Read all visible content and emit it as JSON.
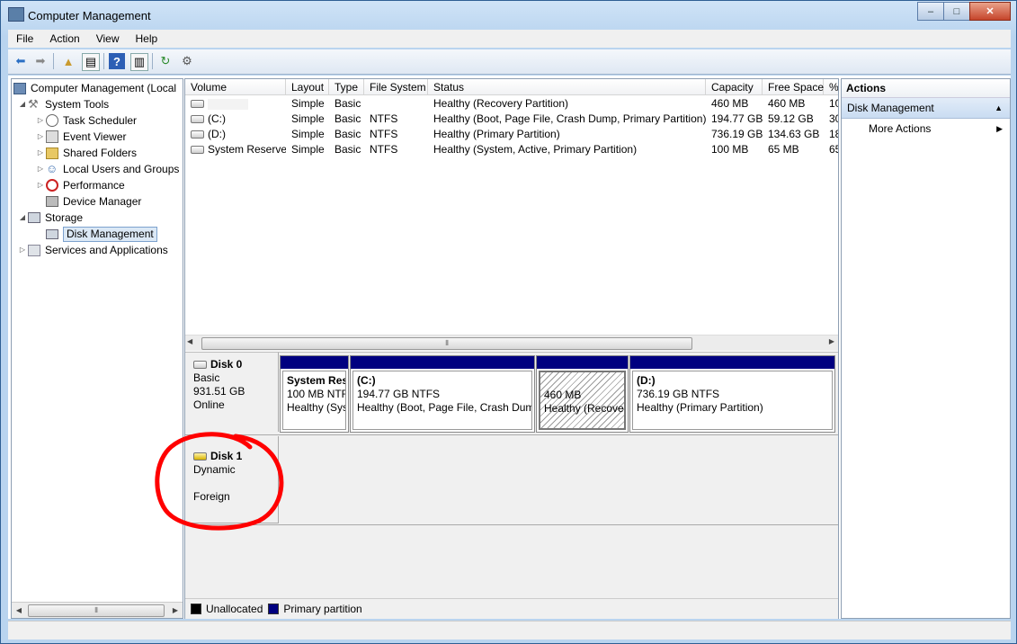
{
  "window": {
    "title": "Computer Management"
  },
  "menu": [
    "File",
    "Action",
    "View",
    "Help"
  ],
  "toolbar_icons": [
    "back-arrow-icon",
    "forward-arrow-icon",
    "up-folder-icon",
    "show-hide-tree-icon",
    "help-icon",
    "show-hide-action-pane-icon",
    "refresh-icon",
    "disk-settings-icon"
  ],
  "tree": {
    "root": "Computer Management (Local",
    "system_tools": "System Tools",
    "task_scheduler": "Task Scheduler",
    "event_viewer": "Event Viewer",
    "shared_folders": "Shared Folders",
    "local_users": "Local Users and Groups",
    "performance": "Performance",
    "device_manager": "Device Manager",
    "storage": "Storage",
    "disk_management": "Disk Management",
    "services": "Services and Applications"
  },
  "volume_list": {
    "headers": [
      "Volume",
      "Layout",
      "Type",
      "File System",
      "Status",
      "Capacity",
      "Free Space",
      "%"
    ],
    "rows": [
      {
        "volume": "",
        "layout": "Simple",
        "type": "Basic",
        "fs": "",
        "status": "Healthy (Recovery Partition)",
        "capacity": "460 MB",
        "free": "460 MB",
        "pct": "10"
      },
      {
        "volume": "(C:)",
        "layout": "Simple",
        "type": "Basic",
        "fs": "NTFS",
        "status": "Healthy (Boot, Page File, Crash Dump, Primary Partition)",
        "capacity": "194.77 GB",
        "free": "59.12 GB",
        "pct": "30"
      },
      {
        "volume": "(D:)",
        "layout": "Simple",
        "type": "Basic",
        "fs": "NTFS",
        "status": "Healthy (Primary Partition)",
        "capacity": "736.19 GB",
        "free": "134.63 GB",
        "pct": "18"
      },
      {
        "volume": "System Reserved",
        "layout": "Simple",
        "type": "Basic",
        "fs": "NTFS",
        "status": "Healthy (System, Active, Primary Partition)",
        "capacity": "100 MB",
        "free": "65 MB",
        "pct": "65"
      }
    ]
  },
  "disks": {
    "disk0": {
      "name": "Disk 0",
      "type": "Basic",
      "size": "931.51 GB",
      "state": "Online",
      "partitions": [
        {
          "title": "System Res",
          "line1": "100 MB NTF",
          "line2": "Healthy (Sys"
        },
        {
          "title": "(C:)",
          "line1": "194.77 GB NTFS",
          "line2": "Healthy (Boot, Page File, Crash Dum"
        },
        {
          "title": "",
          "line1": "460 MB",
          "line2": "Healthy (Recover"
        },
        {
          "title": "(D:)",
          "line1": "736.19 GB NTFS",
          "line2": "Healthy (Primary Partition)"
        }
      ]
    },
    "disk1": {
      "name": "Disk 1",
      "type": "Dynamic",
      "state": "Foreign"
    }
  },
  "legend": {
    "unallocated": "Unallocated",
    "primary": "Primary partition",
    "unallocated_color": "#000000",
    "primary_color": "#000080"
  },
  "actions": {
    "header": "Actions",
    "section": "Disk Management",
    "more": "More Actions"
  },
  "annotation_color": "#ff0000"
}
